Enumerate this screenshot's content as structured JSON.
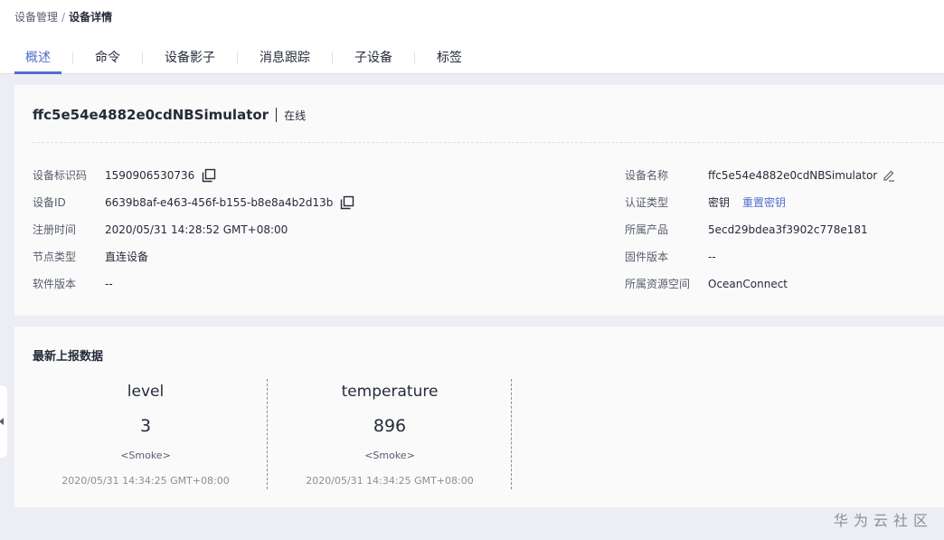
{
  "breadcrumb": {
    "parent": "设备管理",
    "separator": "/",
    "current": "设备详情"
  },
  "tabs": [
    {
      "label": "概述",
      "active": true
    },
    {
      "label": "命令",
      "active": false
    },
    {
      "label": "设备影子",
      "active": false
    },
    {
      "label": "消息跟踪",
      "active": false
    },
    {
      "label": "子设备",
      "active": false
    },
    {
      "label": "标签",
      "active": false
    }
  ],
  "device": {
    "name": "ffc5e54e4882e0cdNBSimulator",
    "status": "在线"
  },
  "info_left": [
    {
      "label": "设备标识码",
      "value": "1590906530736"
    },
    {
      "label": "设备ID",
      "value": "6639b8af-e463-456f-b155-b8e8a4b2d13b"
    },
    {
      "label": "注册时间",
      "value": "2020/05/31 14:28:52 GMT+08:00"
    },
    {
      "label": "节点类型",
      "value": "直连设备"
    },
    {
      "label": "软件版本",
      "value": "--"
    }
  ],
  "info_right": [
    {
      "label": "设备名称",
      "value": "ffc5e54e4882e0cdNBSimulator"
    },
    {
      "label": "认证类型",
      "value": "密钥",
      "link": "重置密钥"
    },
    {
      "label": "所属产品",
      "value": "5ecd29bdea3f3902c778e181"
    },
    {
      "label": "固件版本",
      "value": "--"
    },
    {
      "label": "所属资源空间",
      "value": "OceanConnect"
    }
  ],
  "latest": {
    "title": "最新上报数据",
    "metrics": [
      {
        "name": "level",
        "value": "3",
        "unit": "<Smoke>",
        "time": "2020/05/31 14:34:25 GMT+08:00"
      },
      {
        "name": "temperature",
        "value": "896",
        "unit": "<Smoke>",
        "time": "2020/05/31 14:34:25 GMT+08:00"
      }
    ]
  },
  "watermark": "华为云社区",
  "colors": {
    "accent": "#526ecc",
    "text": "#252b3a",
    "label": "#575d6c",
    "background": "#eceef3"
  },
  "icons": {
    "copy": "copy-icon",
    "edit": "edit-icon",
    "collapse": "chevron-left-icon"
  }
}
